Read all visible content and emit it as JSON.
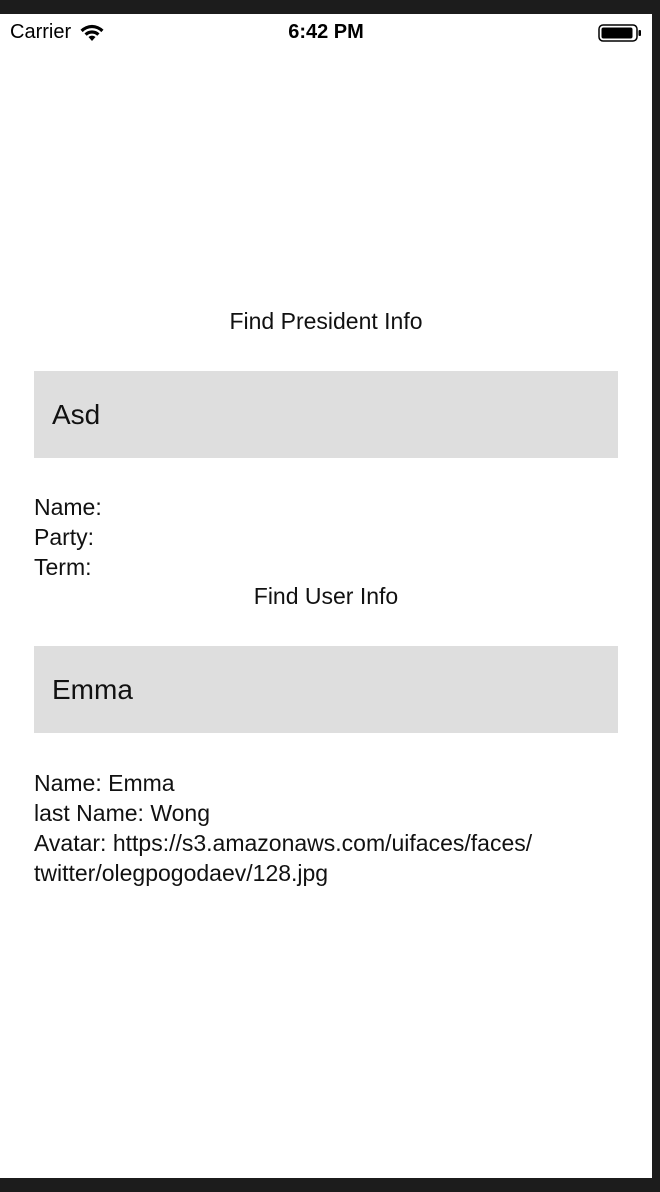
{
  "status_bar": {
    "carrier": "Carrier",
    "time": "6:42 PM",
    "icons": [
      "wifi-icon",
      "battery-icon"
    ]
  },
  "president": {
    "title": "Find President Info",
    "input_value": "Asd",
    "name_line": "Name:",
    "party_line": "Party:",
    "term_line": "Term:"
  },
  "user": {
    "title": "Find User Info",
    "input_value": "Emma",
    "name_line": "Name: Emma",
    "last_name_line": "last Name: Wong",
    "avatar_line": "Avatar: https://s3.amazonaws.com/uifaces/faces/",
    "avatar_line_2": "twitter/olegpogodaev/128.jpg"
  },
  "colors": {
    "input_background": "#dedede",
    "frame": "#1c1c1c",
    "screen_background": "#ffffff"
  }
}
